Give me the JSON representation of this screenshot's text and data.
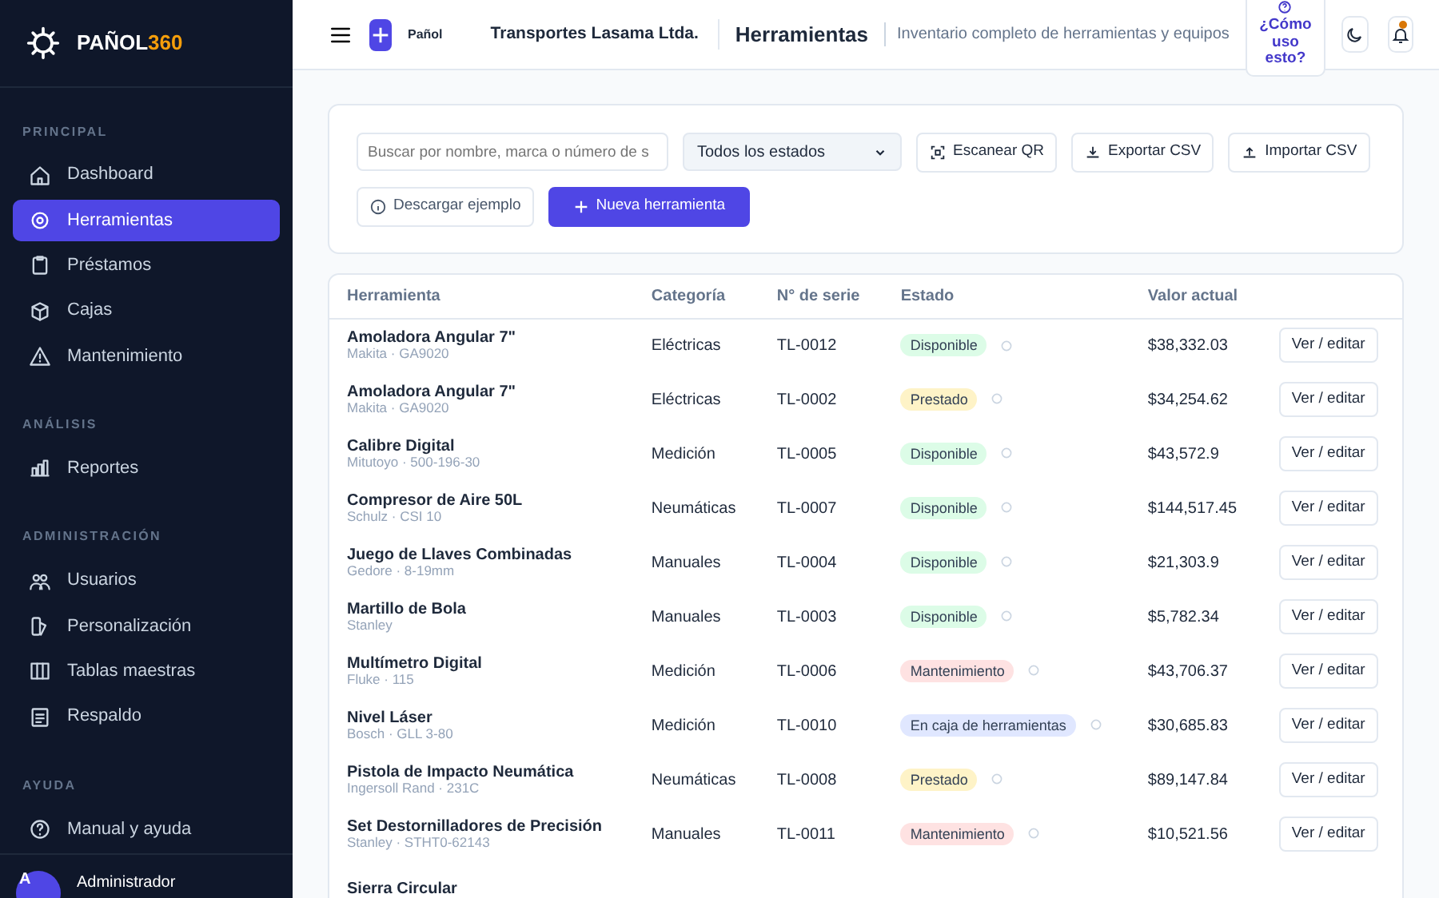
{
  "brand": {
    "name": "PAÑOL",
    "accent": "360"
  },
  "sidebar": {
    "sections": [
      {
        "label": "PRINCIPAL",
        "items": [
          {
            "label": "Dashboard",
            "selected": false
          },
          {
            "label": "Herramientas",
            "selected": true
          },
          {
            "label": "Préstamos",
            "selected": false
          },
          {
            "label": "Cajas",
            "selected": false
          },
          {
            "label": "Mantenimiento",
            "selected": false
          }
        ]
      },
      {
        "label": "ANÁLISIS",
        "items": [
          {
            "label": "Reportes",
            "selected": false
          }
        ]
      },
      {
        "label": "ADMINISTRACIÓN",
        "items": [
          {
            "label": "Usuarios",
            "selected": false
          },
          {
            "label": "Personalización",
            "selected": false
          },
          {
            "label": "Tablas maestras",
            "selected": false
          },
          {
            "label": "Respaldo",
            "selected": false
          }
        ]
      },
      {
        "label": "AYUDA",
        "items": [
          {
            "label": "Manual y ayuda",
            "selected": false
          }
        ]
      }
    ],
    "user": {
      "initial": "A",
      "name": "Administrador"
    }
  },
  "header": {
    "logo_label": "Pañol",
    "company": "Transportes Lasama Ltda.",
    "title": "Herramientas",
    "subtitle": "Inventario completo de herramientas y equipos",
    "help_button": "¿Cómo uso esto?",
    "notifications_unread": true
  },
  "filters": {
    "search": {
      "placeholder": "Buscar por nombre, marca o número de s"
    },
    "status_select": "Todos los estados",
    "buttons": [
      "Escanear QR",
      "Exportar CSV",
      "Importar CSV",
      "Descargar ejemplo"
    ],
    "primary_button": "Nueva herramienta"
  },
  "table": {
    "columns": [
      "Herramienta",
      "Categoría",
      "N° de serie",
      "Estado",
      "Valor actual"
    ],
    "rows": [
      {
        "name": "Amoladora Angular 7\"",
        "detail": "Makita · GA9020",
        "category": "Eléctricas",
        "serial": "TL-0012",
        "status": "Disponible",
        "color": "#dcfce7",
        "value": "$38,332.03",
        "action": "Ver / editar"
      },
      {
        "name": "Amoladora Angular 7\"",
        "detail": "Makita · GA9020",
        "category": "Eléctricas",
        "serial": "TL-0002",
        "status": "Prestado",
        "color": "#fef3c7",
        "value": "$34,254.62",
        "action": "Ver / editar"
      },
      {
        "name": "Calibre Digital",
        "detail": "Mitutoyo · 500-196-30",
        "category": "Medición",
        "serial": "TL-0005",
        "status": "Disponible",
        "color": "#dcfce7",
        "value": "$43,572.9",
        "action": "Ver / editar"
      },
      {
        "name": "Compresor de Aire 50L",
        "detail": "Schulz · CSI 10",
        "category": "Neumáticas",
        "serial": "TL-0007",
        "status": "Disponible",
        "color": "#dcfce7",
        "value": "$144,517.45",
        "action": "Ver / editar"
      },
      {
        "name": "Juego de Llaves Combinadas",
        "detail": "Gedore · 8-19mm",
        "category": "Manuales",
        "serial": "TL-0004",
        "status": "Disponible",
        "color": "#dcfce7",
        "value": "$21,303.9",
        "action": "Ver / editar"
      },
      {
        "name": "Martillo de Bola",
        "detail": "Stanley",
        "category": "Manuales",
        "serial": "TL-0003",
        "status": "Disponible",
        "color": "#dcfce7",
        "value": "$5,782.34",
        "action": "Ver / editar"
      },
      {
        "name": "Multímetro Digital",
        "detail": "Fluke · 115",
        "category": "Medición",
        "serial": "TL-0006",
        "status": "Mantenimiento",
        "color": "#fee2e2",
        "value": "$43,706.37",
        "action": "Ver / editar"
      },
      {
        "name": "Nivel Láser",
        "detail": "Bosch · GLL 3-80",
        "category": "Medición",
        "serial": "TL-0010",
        "status": "En caja de herramientas",
        "color": "#e0e7ff",
        "value": "$30,685.83",
        "action": "Ver / editar"
      },
      {
        "name": "Pistola de Impacto Neumática",
        "detail": "Ingersoll Rand · 231C",
        "category": "Neumáticas",
        "serial": "TL-0008",
        "status": "Prestado",
        "color": "#fef3c7",
        "value": "$89,147.84",
        "action": "Ver / editar"
      },
      {
        "name": "Set Destornilladores de Precisión",
        "detail": "Stanley · STHT0-62143",
        "category": "Manuales",
        "serial": "TL-0011",
        "status": "Mantenimiento",
        "color": "#fee2e2",
        "value": "$10,521.56",
        "action": "Ver / editar"
      },
      {
        "name": "Sierra Circular"
      }
    ]
  }
}
